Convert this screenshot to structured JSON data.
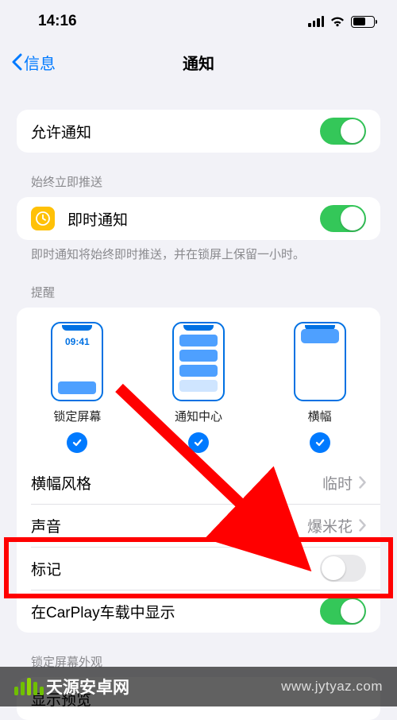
{
  "status_bar": {
    "time": "14:16"
  },
  "nav": {
    "back_label": "信息",
    "title": "通知"
  },
  "allow_notifications": {
    "label": "允许通知",
    "enabled": true
  },
  "time_sensitive": {
    "header": "始终立即推送",
    "label": "即时通知",
    "enabled": true,
    "footer": "即时通知将始终即时推送，并在锁屏上保留一小时。"
  },
  "alerts": {
    "header": "提醒",
    "preview_time": "09:41",
    "styles": [
      {
        "label": "锁定屏幕",
        "checked": true
      },
      {
        "label": "通知中心",
        "checked": true
      },
      {
        "label": "横幅",
        "checked": true
      }
    ],
    "banner_style": {
      "label": "横幅风格",
      "value": "临时"
    },
    "sound": {
      "label": "声音",
      "value": "爆米花"
    },
    "badges": {
      "label": "标记",
      "enabled": false
    },
    "carplay": {
      "label": "在CarPlay车载中显示",
      "enabled": true
    }
  },
  "lock_screen_appearance": {
    "header": "锁定屏幕外观",
    "show_preview": {
      "label": "显示预览"
    }
  },
  "watermark": {
    "brand": "天源安卓网",
    "url": "www.jytyaz.com"
  }
}
